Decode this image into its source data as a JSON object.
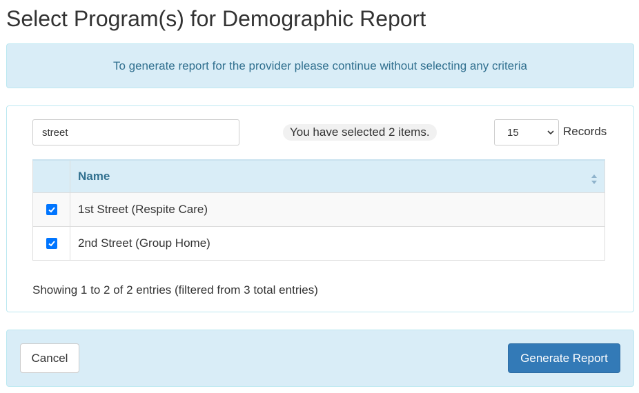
{
  "page": {
    "title": "Select Program(s) for Demographic Report"
  },
  "banner": {
    "text": "To generate report for the provider please continue without selecting any criteria"
  },
  "search": {
    "value": "street"
  },
  "selection": {
    "summary": "You have selected 2 items."
  },
  "records": {
    "selected": "15",
    "label": "Records"
  },
  "table": {
    "columns": [
      "",
      "Name"
    ],
    "rows": [
      {
        "checked": true,
        "name": "1st Street (Respite Care)"
      },
      {
        "checked": true,
        "name": "2nd Street (Group Home)"
      }
    ]
  },
  "table_info": {
    "text": "Showing 1 to 2 of 2 entries (filtered from 3 total entries)"
  },
  "footer": {
    "cancel_label": "Cancel",
    "generate_label": "Generate Report"
  },
  "colors": {
    "info_bg": "#d9edf7",
    "info_text": "#31708f",
    "primary": "#337ab7",
    "checkbox": "#0075ff"
  }
}
